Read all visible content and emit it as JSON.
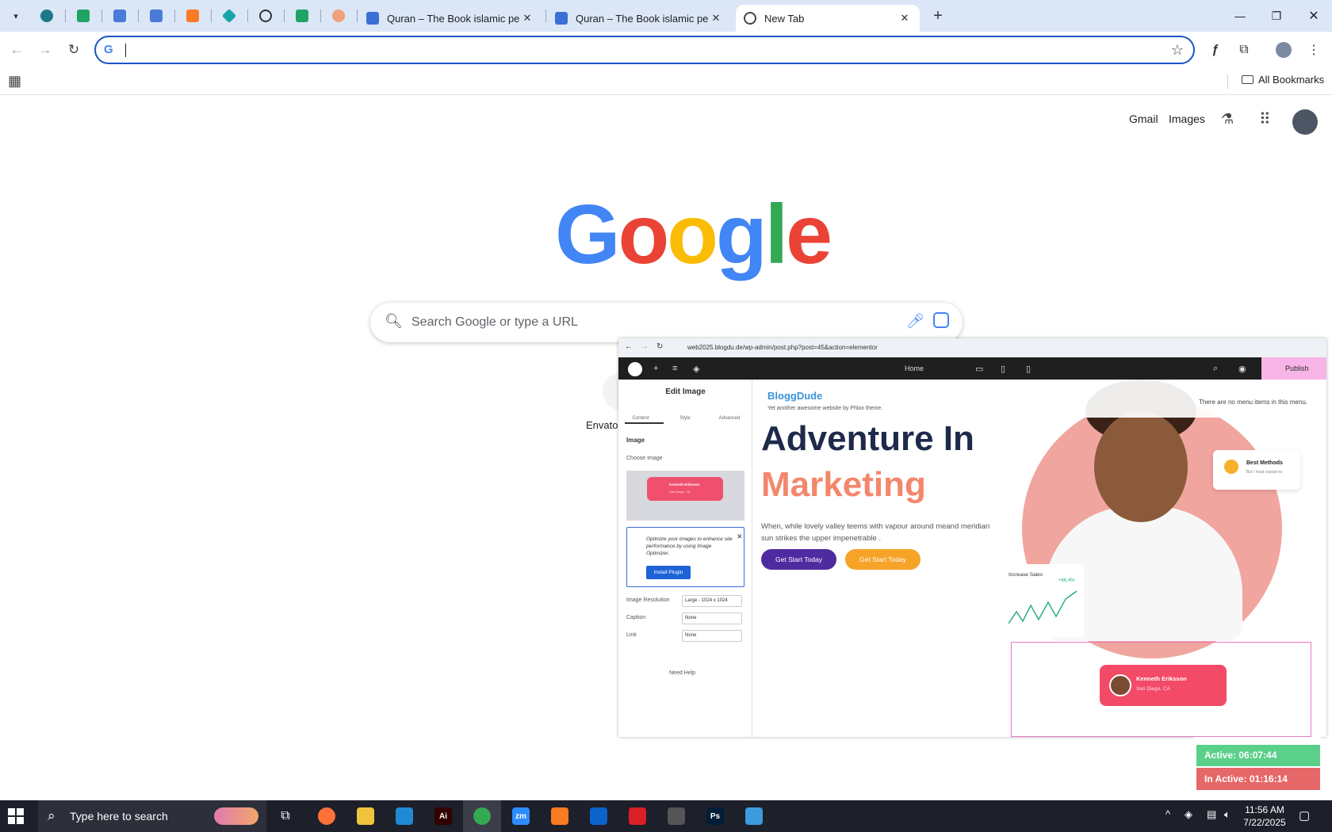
{
  "tabs": [
    {
      "title": "Quran – The Book islamic peop",
      "favicon_color": "#3b6fd6",
      "active": false
    },
    {
      "title": "Quran – The Book islamic peop",
      "favicon_color": "#3b6fd6",
      "active": false
    },
    {
      "title": "New Tab",
      "favicon_color": "#444444",
      "active": true
    }
  ],
  "pinned_tab_icons": [
    "wp-icon",
    "sheets-icon",
    "docs-icon",
    "docs-icon",
    "xampp-icon",
    "prism-icon",
    "openai-icon",
    "sheets-icon",
    "tamil-icon"
  ],
  "toolbar": {
    "omnibox_value": "",
    "bookmarks_all": "All Bookmarks"
  },
  "google": {
    "gmail": "Gmail",
    "images": "Images",
    "logo_text": "Google",
    "search_placeholder": "Search Google or type a URL",
    "shortcut_label": "Envato"
  },
  "overlay": {
    "url": "web2025.blogdu.de/wp-admin/post.php?post=45&action=elementor",
    "home": "Home",
    "publish": "Publish",
    "panel": {
      "title": "Edit Image",
      "tabs": [
        "Content",
        "Style",
        "Advanced"
      ],
      "section": "Image",
      "choose_image": "Choose Image",
      "preview_name": "Kenneth Eriksson",
      "preview_city": "San Diego, CA",
      "notice": "Optimize your images to enhance site performance by using Image Optimizer.",
      "install_button": "Install Plugin",
      "fields": [
        {
          "label": "Image Resolution",
          "value": "Large - 1024 x 1024"
        },
        {
          "label": "Caption",
          "value": "None"
        },
        {
          "label": "Link",
          "value": "None"
        }
      ],
      "help": "Need Help"
    },
    "site": {
      "brand": "BloggDude",
      "tagline": "Yet another awesome website by Phlox theme.",
      "menu_note": "There are no menu items in this menu.",
      "heading1": "Adventure In",
      "heading2": "Marketing",
      "body": "When, while lovely valley teems with vapour around meand meridian sun strikes the upper impenetrable .",
      "button1": "Get Start Today",
      "button2": "Get Start Today",
      "card_title": "Best Methods",
      "card_sub": "But I must explain to",
      "sales_label": "Increase Sales",
      "sales_percent": "+66,4%",
      "person_name": "Kenneth Eriksson",
      "person_city": "San Diego, CA"
    }
  },
  "timer": {
    "active": "Active: 06:07:44",
    "inactive": "In Active: 01:16:14"
  },
  "taskbar": {
    "search_placeholder": "Type here to search",
    "time": "11:56 AM",
    "date": "7/22/2025",
    "apps": [
      {
        "name": "firefox-icon",
        "color": "#ff7139",
        "label": ""
      },
      {
        "name": "file-explorer-icon",
        "color": "#f0c33c",
        "label": ""
      },
      {
        "name": "vscode-icon",
        "color": "#1f8ad2",
        "label": ""
      },
      {
        "name": "illustrator-icon",
        "color": "#330000",
        "label": "Ai"
      },
      {
        "name": "chrome-icon",
        "color": "#34a853",
        "label": ""
      },
      {
        "name": "zoom-icon",
        "color": "#2d8cff",
        "label": "zm"
      },
      {
        "name": "xampp-icon",
        "color": "#fb7a24",
        "label": ""
      },
      {
        "name": "outlook-icon",
        "color": "#0a64c9",
        "label": ""
      },
      {
        "name": "creative-cloud-icon",
        "color": "#da1f26",
        "label": ""
      },
      {
        "name": "pen-tool-icon",
        "color": "#555555",
        "label": ""
      },
      {
        "name": "photoshop-icon",
        "color": "#001e36",
        "label": "Ps"
      },
      {
        "name": "app-icon",
        "color": "#3b9bdc",
        "label": ""
      }
    ]
  }
}
